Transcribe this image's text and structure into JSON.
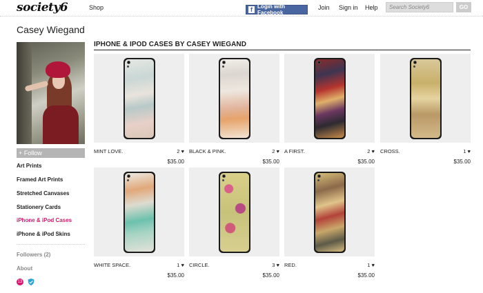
{
  "nav": {
    "logo": "society6",
    "shop": "Shop",
    "facebook_login": "Login with Facebook",
    "join": "Join",
    "sign_in": "Sign in",
    "help": "Help",
    "search_placeholder": "Search Society6",
    "go": "GO"
  },
  "artist": {
    "name": "Casey Wiegand"
  },
  "sidebar": {
    "follow": "+ Follow",
    "items": [
      {
        "label": "Art Prints"
      },
      {
        "label": "Framed Art Prints"
      },
      {
        "label": "Stretched Canvases"
      },
      {
        "label": "Stationery Cards"
      },
      {
        "label": "iPhone & iPod Cases"
      },
      {
        "label": "iPhone & iPod Skins"
      }
    ],
    "followers": "Followers (2)",
    "about": "About",
    "badge_count": "13"
  },
  "main": {
    "section_title": "IPHONE & IPOD CASES BY CASEY WIEGAND",
    "products": [
      {
        "name": "MINT LOVE.",
        "likes": "2",
        "price": "$35.00"
      },
      {
        "name": "BLACK & PINK.",
        "likes": "2",
        "price": "$35.00"
      },
      {
        "name": "A FIRST.",
        "likes": "2",
        "price": "$35.00"
      },
      {
        "name": "CROSS.",
        "likes": "1",
        "price": "$35.00"
      },
      {
        "name": "WHITE SPACE.",
        "likes": "1",
        "price": "$35.00"
      },
      {
        "name": "CIRCLE.",
        "likes": "3",
        "price": "$35.00"
      },
      {
        "name": "RED.",
        "likes": "1",
        "price": "$35.00"
      }
    ]
  },
  "colors": {
    "accent": "#d6176b",
    "facebook": "#4a66a0"
  }
}
